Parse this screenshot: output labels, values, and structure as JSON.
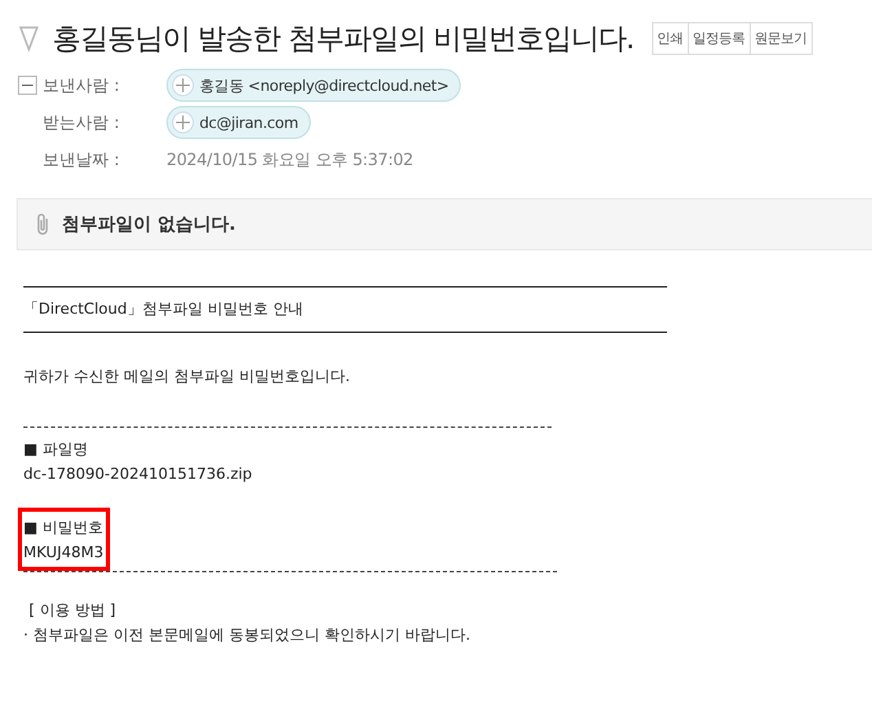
{
  "subject": "홍길동님이 발송한 첨부파일의 비밀번호입니다.",
  "actions": [
    "인쇄",
    "일정등록",
    "원문보기"
  ],
  "header": {
    "expanded": true,
    "fields": [
      {
        "label": "보낸사람 :",
        "chip": "홍길동 <noreply@directcloud.net>"
      },
      {
        "label": "받는사람 :",
        "chip": "dc@jiran.com"
      },
      {
        "label": "보낸날짜 :",
        "value": "2024/10/15 화요일 오후 5:37:02"
      }
    ]
  },
  "attachments": {
    "message": "첨부파일이 없습니다."
  },
  "body": {
    "heading": "「DirectCloud」첨부파일 비밀번호 안내",
    "intro": "귀하가 수신한 메일의 첨부파일 비밀번호입니다.",
    "file_label": "■ 파일명",
    "file_name": "dc-178090-202410151736.zip",
    "password_label": "■ 비밀번호",
    "password": "MKUJ48M3",
    "usage_title": "[ 이용 방법 ]",
    "usage_note": "· 첨부파일은 이전 본문메일에 동봉되었으니 확인하시기 바랍니다."
  }
}
